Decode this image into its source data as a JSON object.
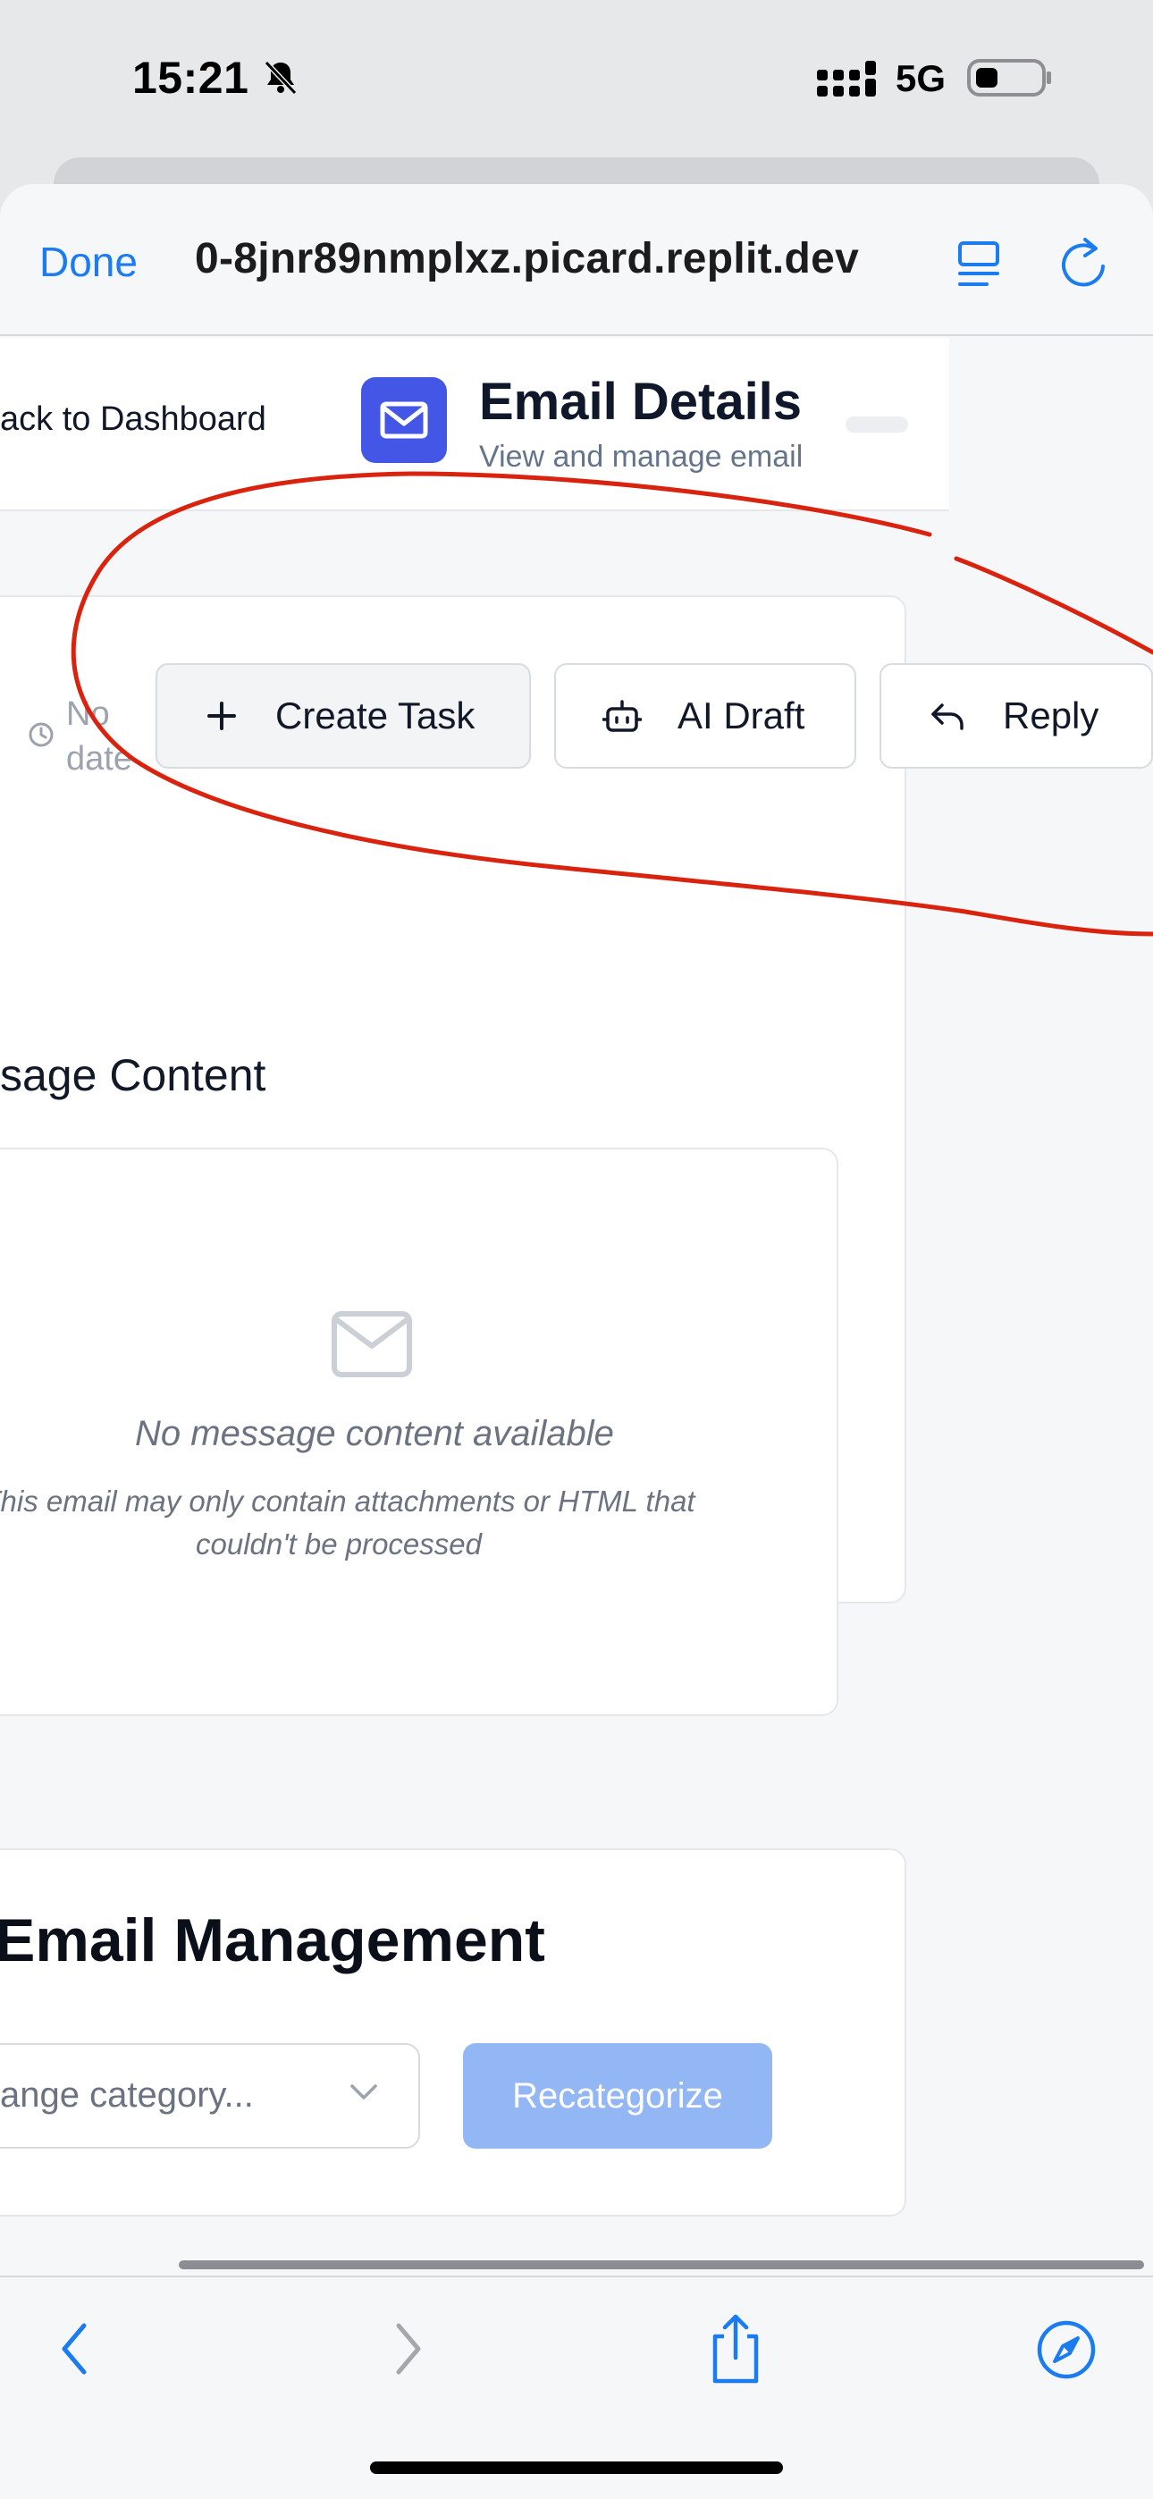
{
  "status_bar": {
    "time": "15:21",
    "network": "5G"
  },
  "browser": {
    "done_label": "Done",
    "url": "0-8jnr89nmplxz.picard.replit.dev"
  },
  "header": {
    "back_link": "ack to Dashboard",
    "title": "Email Details",
    "subtitle": "View and manage email"
  },
  "email": {
    "date": "No date",
    "actions": [
      {
        "label": "Create Task",
        "icon": "plus-icon"
      },
      {
        "label": "AI Draft",
        "icon": "bot-icon"
      },
      {
        "label": "Reply",
        "icon": "reply-icon"
      }
    ],
    "content_heading": "sage Content",
    "empty_title": "No message content available",
    "empty_description": "This email may only contain attachments or HTML that couldn't be processed"
  },
  "management": {
    "title": "Email Management",
    "category_placeholder": "ange category...",
    "recategorize_label": "Recategorize"
  },
  "colors": {
    "accent_blue": "#1a7cf0",
    "brand_indigo": "#4356e6",
    "recategorize_disabled": "#93b6f5",
    "annotation_red": "#d9230f"
  }
}
